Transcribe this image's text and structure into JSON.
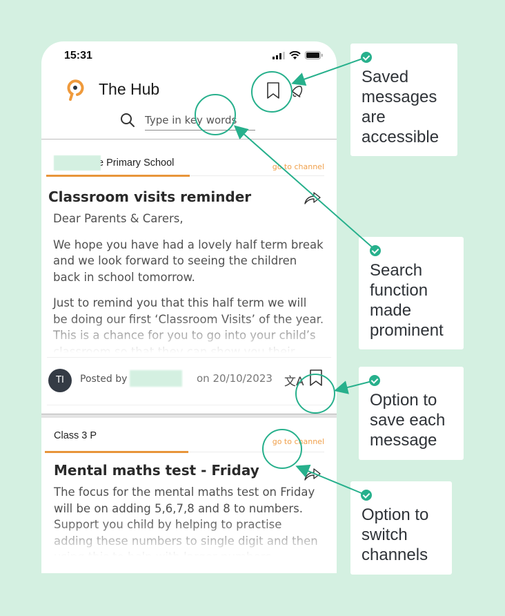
{
  "status_bar": {
    "time": "15:31"
  },
  "header": {
    "title": "The Hub",
    "search_placeholder": "Type in key words"
  },
  "posts": [
    {
      "channel": "e Primary School",
      "go_to_channel": "go to channel",
      "title": "Classroom visits reminder",
      "paragraphs": [
        "Dear Parents & Carers,",
        "We hope you have had a lovely half term break and we look forward to seeing the children back in school tomorrow.",
        "Just to remind you that this half term we will be doing our first ‘Classroom Visits’ of the year. This is a chance for you to go into your child’s classroom so that they can show you their"
      ],
      "avatar_initials": "TI",
      "posted_by_label": "Posted by",
      "date": "on 20/10/2023"
    },
    {
      "channel": "Class 3 P",
      "go_to_channel": "go to channel",
      "title": "Mental maths test - Friday",
      "paragraphs": [
        "The focus for the mental maths test on Friday will be on adding 5,6,7,8 and 8 to numbers. Support you child by helping to practise adding these numbers to single digit and then using this to help with larger numbers."
      ]
    }
  ],
  "callouts": [
    {
      "text": "Saved messages are accessible"
    },
    {
      "text": "Search function made prominent"
    },
    {
      "text": "Option to save each message"
    },
    {
      "text": "Option to switch channels"
    }
  ],
  "colors": {
    "background": "#d4f0e1",
    "annotation": "#27b08c",
    "accent_orange": "#e8953a",
    "link_orange": "#f0a04b"
  }
}
